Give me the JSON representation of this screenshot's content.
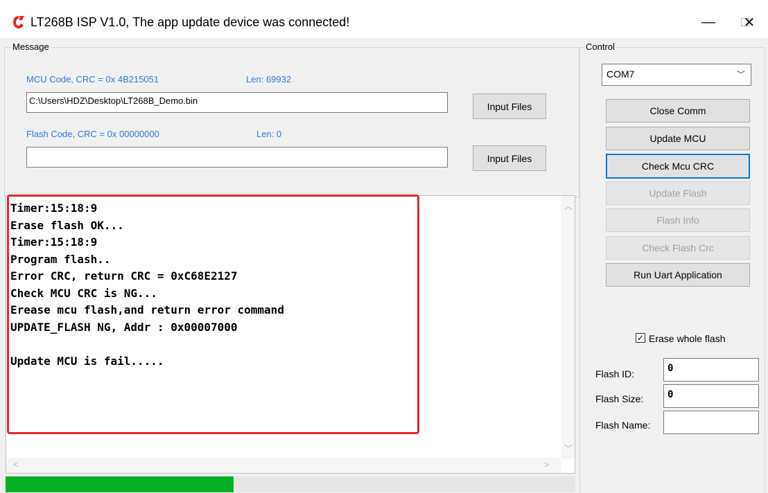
{
  "window": {
    "title": "LT268B ISP V1.0, The app update device was connected!",
    "minimize_glyph": "—",
    "maximize_glyph": "□",
    "close_glyph": "✕"
  },
  "message": {
    "group_label": "Message",
    "mcu_crc_label": "MCU Code, CRC = 0x 4B215051",
    "mcu_len_label": "Len:  69932",
    "mcu_path": "C:\\Users\\HDZ\\Desktop\\LT268B_Demo.bin",
    "mcu_input_button": "Input Files",
    "flash_crc_label": "Flash Code, CRC = 0x 00000000",
    "flash_len_label": "Len:  0",
    "flash_path": "",
    "flash_input_button": "Input Files"
  },
  "log": {
    "lines": "Timer:15:18:9\nErase flash OK...\nTimer:15:18:9\nProgram flash..\nError CRC, return CRC = 0xC68E2127\nCheck MCU CRC is NG...\nErease mcu flash,and return error command\nUPDATE_FLASH NG, Addr : 0x00007000\n\nUpdate MCU is fail....."
  },
  "progress": {
    "value_fraction": 0.4,
    "color": "#06b025"
  },
  "control": {
    "group_label": "Control",
    "com_port": "COM7",
    "buttons": {
      "close_comm": "Close Comm",
      "update_mcu": "Update MCU",
      "check_mcu_crc": "Check Mcu CRC",
      "update_flash": "Update Flash",
      "flash_info": "Flash Info",
      "check_flash_crc": "Check Flash Crc",
      "run_uart": "Run Uart Application"
    },
    "erase_whole_flash_label": "Erase whole flash",
    "erase_whole_flash_checked": true,
    "flash_id_label": "Flash ID:",
    "flash_id_value": "0",
    "flash_size_label": "Flash Size:",
    "flash_size_value": "0",
    "flash_name_label": "Flash Name:",
    "flash_name_value": ""
  },
  "colors": {
    "accent_blue": "#2b7bd8",
    "highlight_red": "#e8262a",
    "focus_blue": "#0078d7"
  }
}
